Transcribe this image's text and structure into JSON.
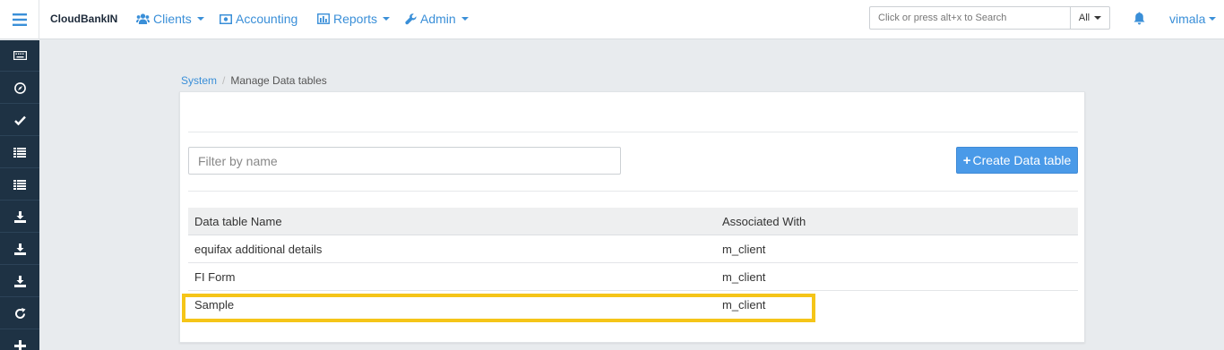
{
  "app": {
    "brand": "CloudBankIN"
  },
  "nav": {
    "clients": "Clients",
    "accounting": "Accounting",
    "reports": "Reports",
    "admin": "Admin"
  },
  "search": {
    "placeholder": "Click or press alt+x to Search",
    "scope": "All"
  },
  "user": {
    "name": "vimala"
  },
  "sidebar": {
    "icons": [
      "keyboard-icon",
      "compass-icon",
      "check-icon",
      "list-icon",
      "list-icon",
      "download-icon",
      "download-icon",
      "download-icon",
      "refresh-icon",
      "plus-icon"
    ]
  },
  "breadcrumb": {
    "parent": "System",
    "separator": "/",
    "current": "Manage Data tables"
  },
  "filter": {
    "placeholder": "Filter by name",
    "value": ""
  },
  "create_button": {
    "icon": "+",
    "label": "Create Data table"
  },
  "table": {
    "headers": {
      "name": "Data table Name",
      "associated": "Associated With"
    },
    "rows": [
      {
        "name": "equifax additional details",
        "associated": "m_client"
      },
      {
        "name": "FI Form",
        "associated": "m_client"
      },
      {
        "name": "Sample",
        "associated": "m_client"
      }
    ]
  },
  "colors": {
    "accent": "#3a8fd8",
    "sidebar": "#1e3244",
    "button": "#4a9ae8",
    "highlight": "#f5c518"
  }
}
